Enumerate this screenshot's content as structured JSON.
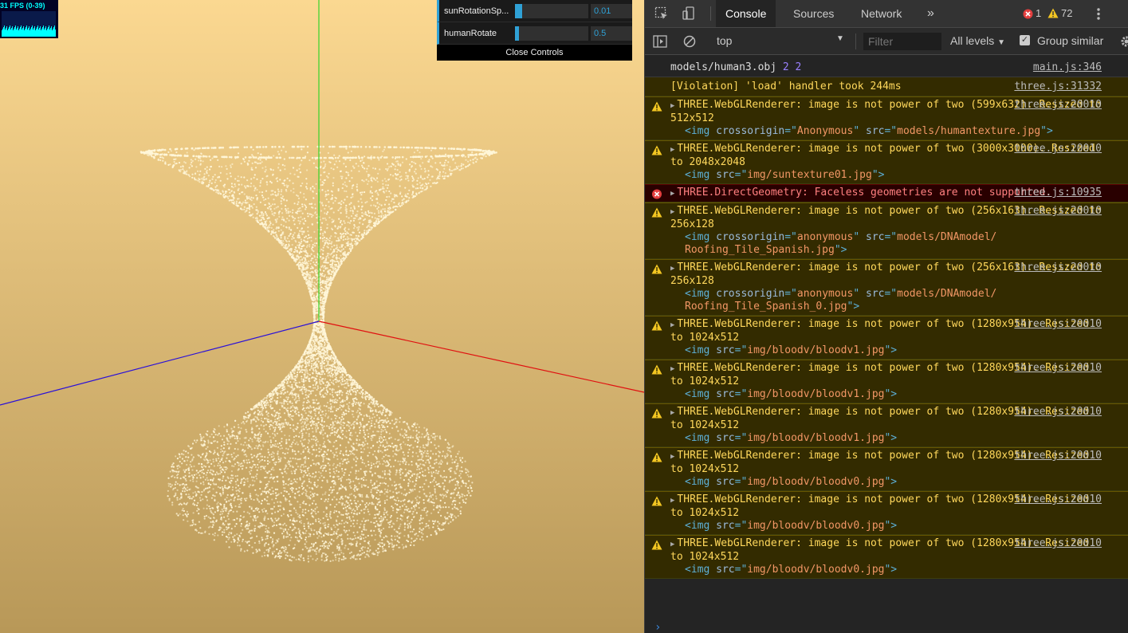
{
  "stats": {
    "fps_label": "31 FPS (0-39)"
  },
  "gui": {
    "controls": [
      {
        "label": "sunRotationSp...",
        "value": "0.01",
        "fill": 0.1
      },
      {
        "label": "humanRotate",
        "value": "0.5",
        "fill": 0.05
      }
    ],
    "close_label": "Close Controls"
  },
  "scene": {
    "background_top": "#fbd891",
    "background_bottom": "#b89858",
    "particle_color": "#fff6d8"
  },
  "devtools": {
    "tabs": [
      "Console",
      "Sources",
      "Network"
    ],
    "more_tabs": "»",
    "error_count": "1",
    "warning_count": "72",
    "context": "top",
    "filter_placeholder": "Filter",
    "levels": "All levels",
    "group_similar": "Group similar"
  },
  "console": {
    "top": {
      "text": "models/human3.obj",
      "n1": "2",
      "n2": "2",
      "src": "main.js:346"
    },
    "violation": {
      "text": "[Violation] 'load' handler took 244ms",
      "src": "three.js:31332"
    },
    "messages": [
      {
        "type": "warn",
        "text": "THREE.WebGLRenderer: image is not power of two (599x632). Resized to 512x512",
        "src": "three.js:20010",
        "child": {
          "tag": "<img ",
          "attrs": [
            [
              "crossorigin",
              "Anonymous"
            ],
            [
              "src",
              "models/humantexture.jpg"
            ]
          ]
        }
      },
      {
        "type": "warn",
        "text": "THREE.WebGLRenderer: image is not power of two (3000x3000). Resized to 2048x2048",
        "src": "three.js:20010",
        "child": {
          "tag": "<img ",
          "attrs": [
            [
              "src",
              "img/suntexture01.jpg"
            ]
          ]
        }
      },
      {
        "type": "err",
        "text": "THREE.DirectGeometry: Faceless geometries are not supported.",
        "src": "three.js:10935"
      },
      {
        "type": "warn",
        "text": "THREE.WebGLRenderer: image is not power of two (256x163). Resized to 256x128",
        "src": "three.js:20010",
        "child": {
          "tag": "<img ",
          "attrs": [
            [
              "crossorigin",
              "anonymous"
            ],
            [
              "src",
              "models/DNAmodel/ Roofing_Tile_Spanish.jpg"
            ]
          ]
        }
      },
      {
        "type": "warn",
        "text": "THREE.WebGLRenderer: image is not power of two (256x163). Resized to 256x128",
        "src": "three.js:20010",
        "child": {
          "tag": "<img ",
          "attrs": [
            [
              "crossorigin",
              "anonymous"
            ],
            [
              "src",
              "models/DNAmodel/ Roofing_Tile_Spanish_0.jpg"
            ]
          ]
        }
      },
      {
        "type": "warn",
        "text": "THREE.WebGLRenderer: image is not power of two (1280x954). Resized to 1024x512",
        "src": "three.js:20010",
        "child": {
          "tag": "<img ",
          "attrs": [
            [
              "src",
              "img/bloodv/bloodv1.jpg"
            ]
          ]
        }
      },
      {
        "type": "warn",
        "text": "THREE.WebGLRenderer: image is not power of two (1280x954). Resized to 1024x512",
        "src": "three.js:20010",
        "child": {
          "tag": "<img ",
          "attrs": [
            [
              "src",
              "img/bloodv/bloodv1.jpg"
            ]
          ]
        }
      },
      {
        "type": "warn",
        "text": "THREE.WebGLRenderer: image is not power of two (1280x954). Resized to 1024x512",
        "src": "three.js:20010",
        "child": {
          "tag": "<img ",
          "attrs": [
            [
              "src",
              "img/bloodv/bloodv1.jpg"
            ]
          ]
        }
      },
      {
        "type": "warn",
        "text": "THREE.WebGLRenderer: image is not power of two (1280x954). Resized to 1024x512",
        "src": "three.js:20010",
        "child": {
          "tag": "<img ",
          "attrs": [
            [
              "src",
              "img/bloodv/bloodv0.jpg"
            ]
          ]
        }
      },
      {
        "type": "warn",
        "text": "THREE.WebGLRenderer: image is not power of two (1280x954). Resized to 1024x512",
        "src": "three.js:20010",
        "child": {
          "tag": "<img ",
          "attrs": [
            [
              "src",
              "img/bloodv/bloodv0.jpg"
            ]
          ]
        }
      },
      {
        "type": "warn",
        "text": "THREE.WebGLRenderer: image is not power of two (1280x954). Resized to 1024x512",
        "src": "three.js:20010",
        "child": {
          "tag": "<img ",
          "attrs": [
            [
              "src",
              "img/bloodv/bloodv0.jpg"
            ]
          ]
        }
      }
    ],
    "prompt": "›"
  }
}
